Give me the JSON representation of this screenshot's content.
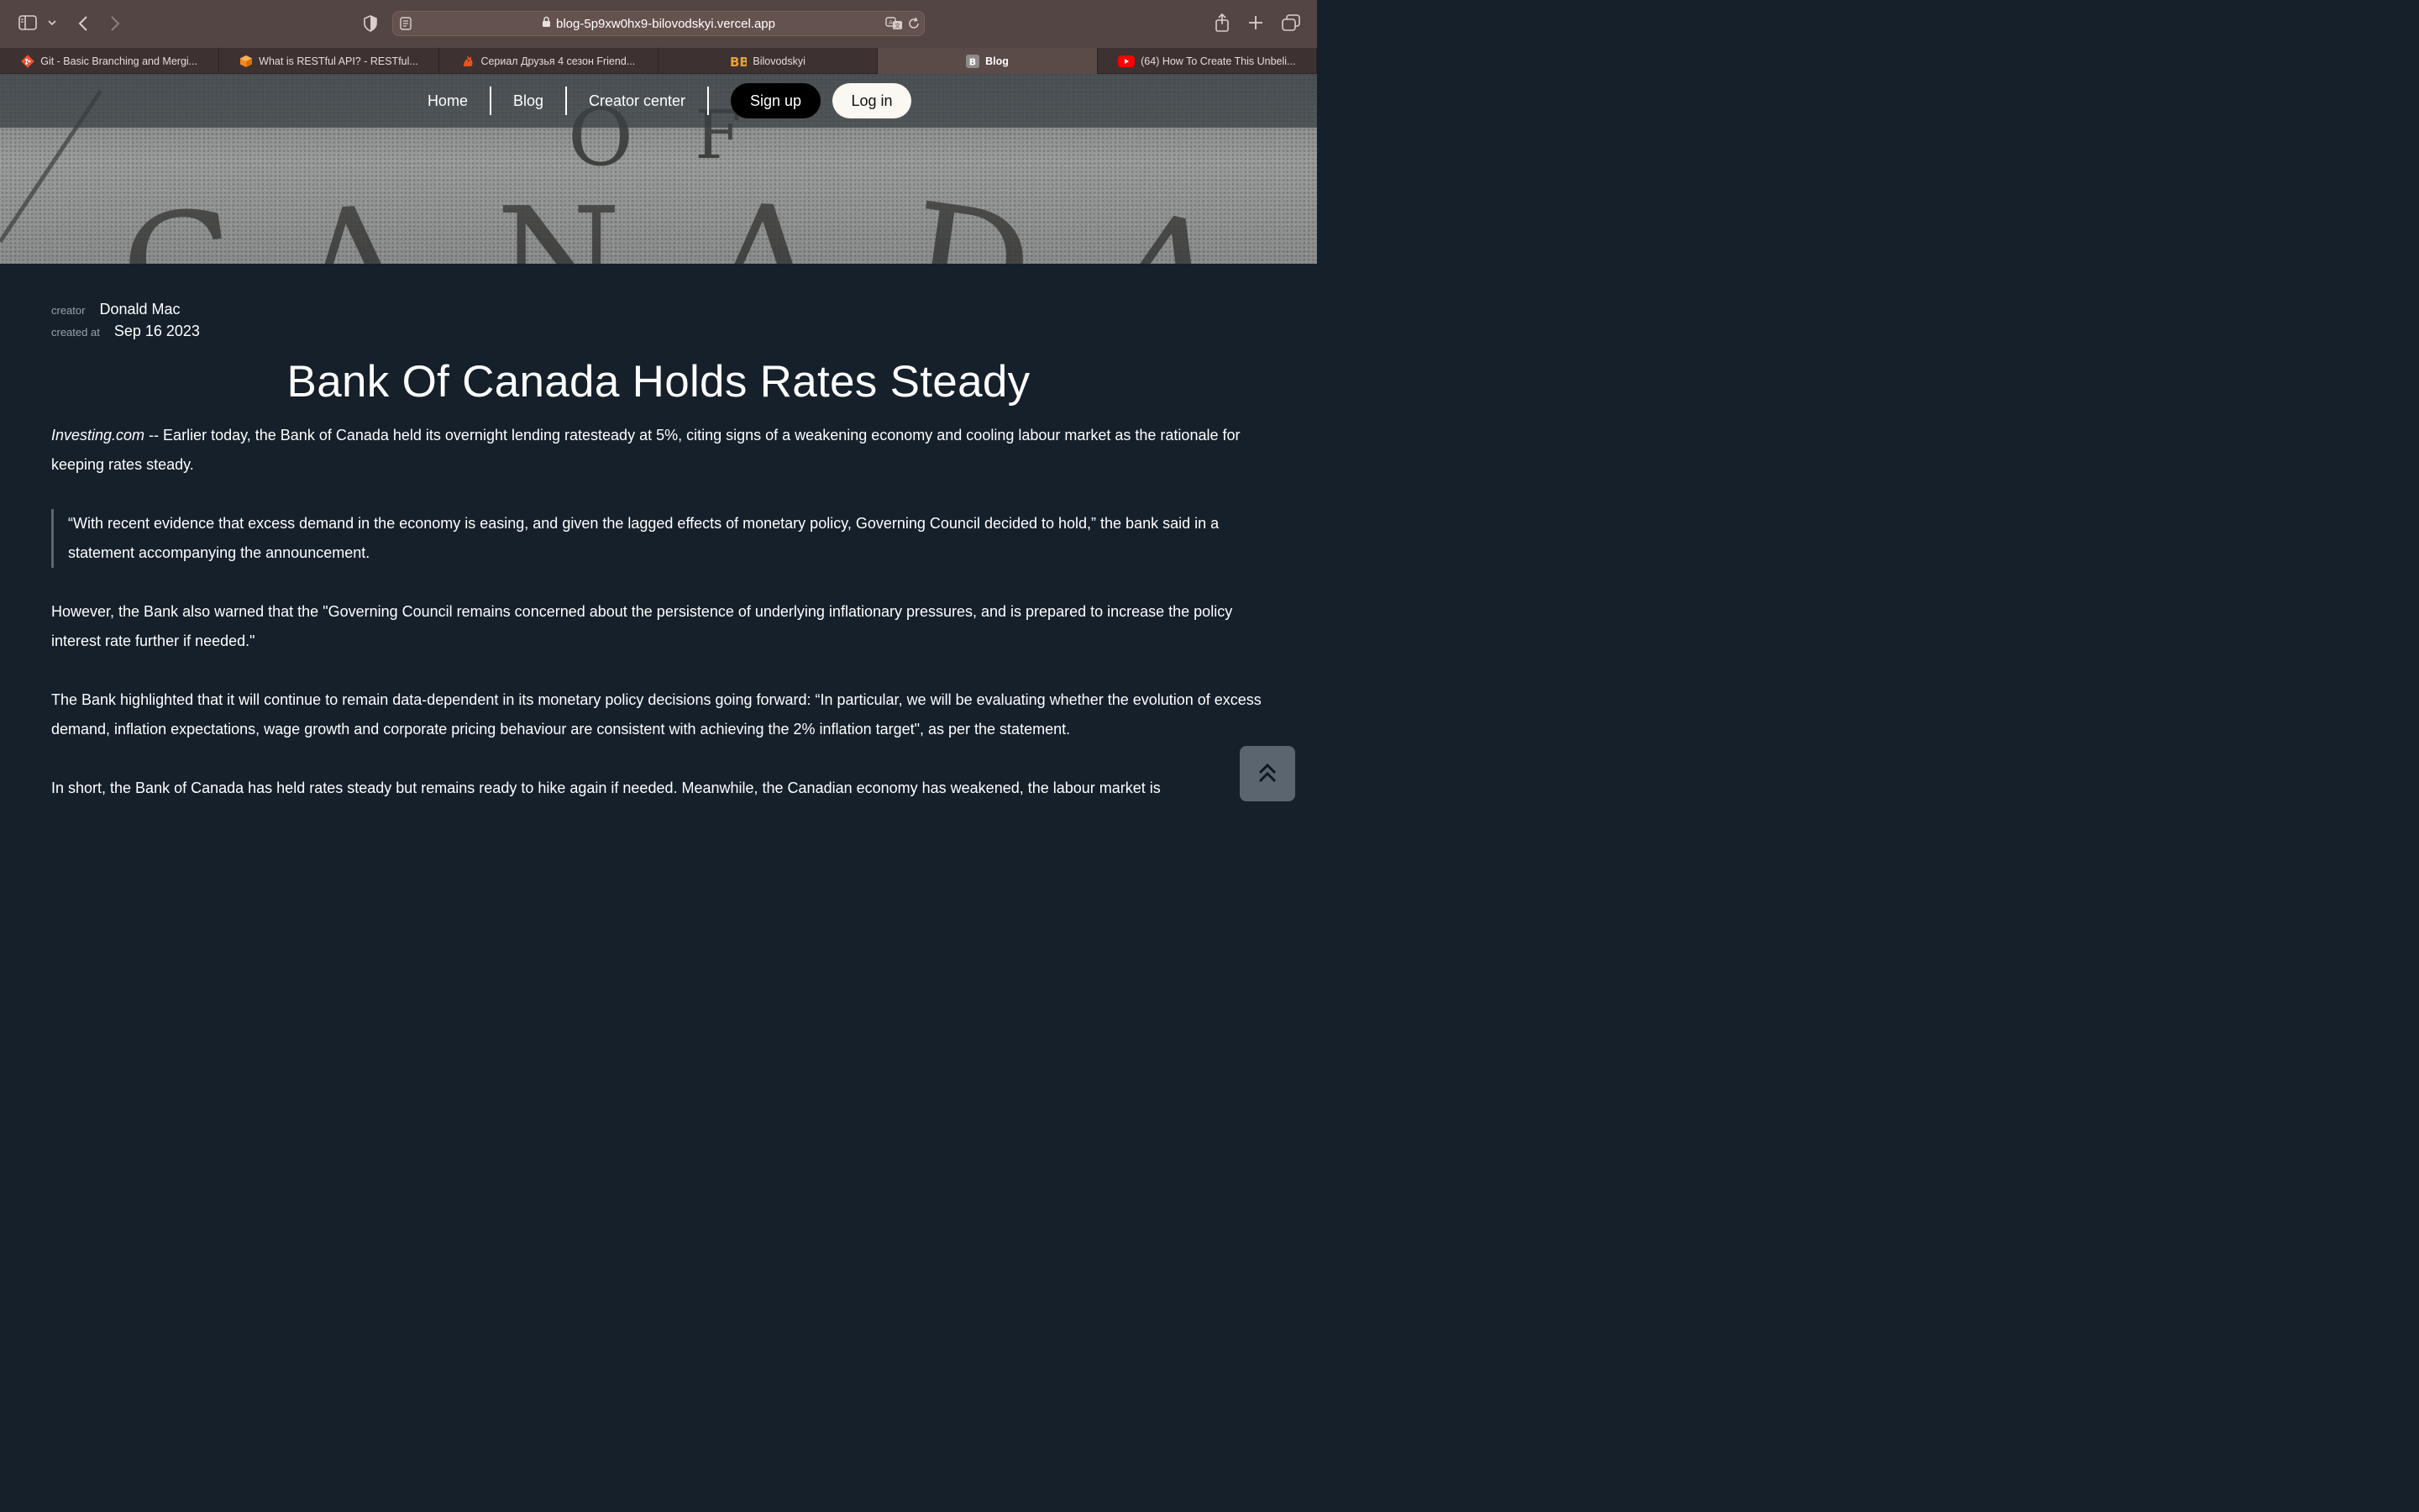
{
  "browser": {
    "url": "blog-5p9xw0hx9-bilovodskyi.vercel.app",
    "tabs": [
      {
        "title": "Git - Basic Branching and Mergi...",
        "icon": "git-icon",
        "active": false
      },
      {
        "title": "What is RESTful API? - RESTful...",
        "icon": "cube-icon",
        "active": false
      },
      {
        "title": "Сериал Друзья 4 сезон Friend...",
        "icon": "fox-icon",
        "active": false
      },
      {
        "title": "Bilovodskyi",
        "icon": "bb-logo-icon",
        "active": false
      },
      {
        "title": "Blog",
        "icon": "b-letter-icon",
        "active": true
      },
      {
        "title": "(64) How To Create This Unbeli...",
        "icon": "youtube-icon",
        "active": false
      }
    ]
  },
  "nav": {
    "home": "Home",
    "blog": "Blog",
    "creator_center": "Creator center",
    "signup": "Sign up",
    "login": "Log in"
  },
  "hero_letters": [
    "O",
    "F",
    "C",
    "A",
    "N",
    "A",
    "D",
    "A"
  ],
  "article": {
    "creator_label": "creator",
    "creator": "Donald Mac",
    "created_label": "created at",
    "created": "Sep 16 2023",
    "title": "Bank Of Canada Holds Rates Steady",
    "p1_source": "Investing.com",
    "p1_text": " -- Earlier today, the Bank of Canada held its overnight lending ratesteady at 5%, citing signs of a weakening economy and cooling labour market as the rationale for keeping rates steady.",
    "quote": "“With recent evidence that excess demand in the economy is easing, and given the lagged effects of monetary policy, Governing Council decided to hold,” the bank said in a statement accompanying the announcement.",
    "p2": "However, the Bank also warned that the \"Governing Council remains concerned about the persistence of underlying inflationary pressures, and is prepared to increase the policy interest rate further if needed.\"",
    "p3": "The Bank highlighted that it will continue to remain data-dependent in its monetary policy decisions going forward: “In particular, we will be evaluating whether the evolution of excess demand, inflation expectations, wage growth and corporate pricing behaviour are consistent with achieving the 2% inflation target\", as per the statement.",
    "p4": "In short, the Bank of Canada has held rates steady but remains ready to hike again if needed. Meanwhile, the Canadian economy has weakened, the labour market is"
  },
  "colors": {
    "page_bg": "#15202a",
    "chrome_bg": "#534543",
    "tabstrip_bg": "#3d3231",
    "scroll_button": "#5a6570"
  }
}
